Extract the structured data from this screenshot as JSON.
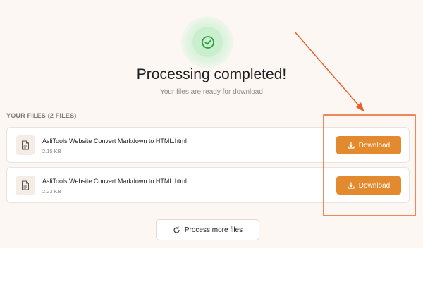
{
  "header": {
    "status_icon": "check-circle-icon",
    "title": "Processing completed!",
    "subtitle": "Your files are ready for download"
  },
  "files_section": {
    "label": "YOUR FILES (2 FILES)",
    "files": [
      {
        "name": "AsliTools Website Convert Markdown to HTML.html",
        "size": "2.15 KB",
        "download_label": "Download",
        "icon": "file-icon"
      },
      {
        "name": "AsliTools Website Convert Markdown to HTML.html",
        "size": "2.23 KB",
        "download_label": "Download",
        "icon": "file-icon"
      }
    ]
  },
  "actions": {
    "process_more_label": "Process more files",
    "process_more_icon": "refresh-icon"
  },
  "annotation": {
    "color": "#e8632a"
  },
  "colors": {
    "accent": "#e38a2f",
    "success": "#2f9e44",
    "background": "#fcf7f3"
  }
}
